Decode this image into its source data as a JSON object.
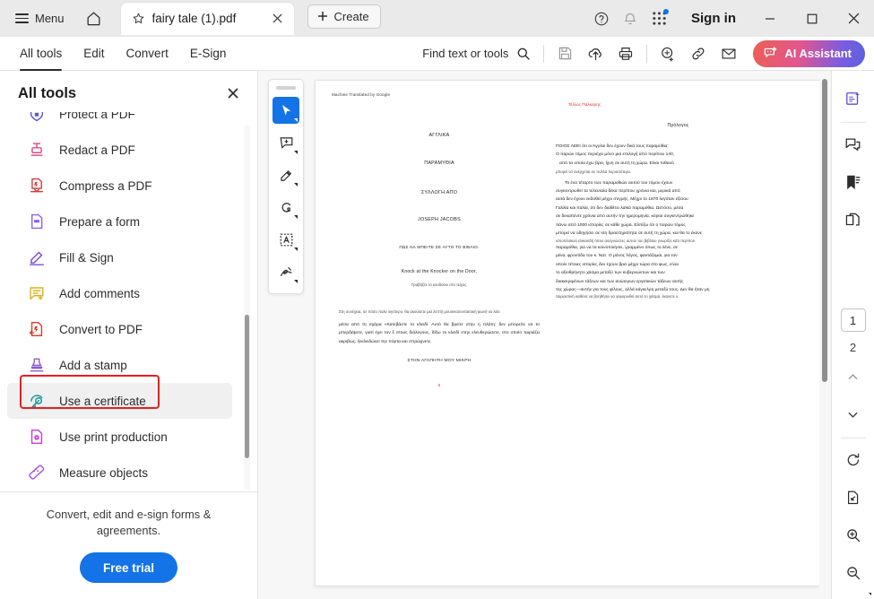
{
  "titlebar": {
    "menu_label": "Menu",
    "home_icon": "home-icon",
    "tab": {
      "favorite_icon": "star-icon",
      "title": "fairy tale (1).pdf",
      "close_icon": "close-icon"
    },
    "create_label": "Create",
    "help_icon": "help-circle-icon",
    "notification_icon": "bell-icon",
    "apps_icon": "apps-grid-icon",
    "signin_label": "Sign in",
    "minimize_icon": "minimize-icon",
    "maximize_icon": "maximize-icon",
    "close_icon": "window-close-icon"
  },
  "menubar": {
    "tabs": [
      {
        "label": "All tools",
        "active": true
      },
      {
        "label": "Edit",
        "active": false
      },
      {
        "label": "Convert",
        "active": false
      },
      {
        "label": "E-Sign",
        "active": false
      }
    ],
    "find_label": "Find text or tools",
    "find_icon": "search-icon",
    "actions": [
      {
        "name": "save-icon"
      },
      {
        "name": "cloud-upload-icon"
      },
      {
        "name": "print-icon"
      },
      {
        "name": "add-stamp-icon"
      },
      {
        "name": "link-icon"
      },
      {
        "name": "email-icon"
      }
    ],
    "ai_label": "AI Assistant",
    "ai_icon": "ai-sparkle-icon",
    "ai_gradient_from": "#ec5f52",
    "ai_gradient_to": "#5b62e0"
  },
  "sidebar": {
    "title": "All tools",
    "close_icon": "close-icon",
    "items": [
      {
        "label": "Protect a PDF",
        "icon": "shield-lock-icon",
        "color": "#5a5ad6",
        "clipped": true
      },
      {
        "label": "Redact a PDF",
        "icon": "redact-icon",
        "color": "#e34a8c"
      },
      {
        "label": "Compress a PDF",
        "icon": "compress-icon",
        "color": "#d43a3a"
      },
      {
        "label": "Prepare a form",
        "icon": "form-icon",
        "color": "#8b5cf0"
      },
      {
        "label": "Fill & Sign",
        "icon": "pen-sign-icon",
        "color": "#7b4ce0"
      },
      {
        "label": "Add comments",
        "icon": "comment-plus-icon",
        "color": "#e0b21a"
      },
      {
        "label": "Convert to PDF",
        "icon": "convert-pdf-icon",
        "color": "#e0392e"
      },
      {
        "label": "Add a stamp",
        "icon": "stamp-icon",
        "color": "#8a5ad0"
      },
      {
        "label": "Use a certificate",
        "icon": "certificate-icon",
        "color": "#1f9a9a",
        "highlighted": true
      },
      {
        "label": "Use print production",
        "icon": "print-production-icon",
        "color": "#c93ccf"
      },
      {
        "label": "Measure objects",
        "icon": "ruler-icon",
        "color": "#a64ce0"
      }
    ],
    "footer_text": "Convert, edit and e-sign forms & agreements.",
    "trial_button": "Free trial",
    "highlight_color": "#ef1a1a"
  },
  "viewer_tools": {
    "grip": "drag-handle",
    "buttons": [
      {
        "name": "select-tool-icon",
        "active": true
      },
      {
        "name": "add-comment-tool-icon",
        "active": false
      },
      {
        "name": "highlight-tool-icon",
        "active": false
      },
      {
        "name": "draw-tool-icon",
        "active": false
      },
      {
        "name": "text-select-tool-icon",
        "active": false
      },
      {
        "name": "signature-tool-icon",
        "active": false
      }
    ]
  },
  "document": {
    "watermark": "Machine Translated by Google",
    "red_header": "Τέλλος Πάλκαρης",
    "left_column": {
      "lines": [
        "ΑΓΓΛΙΚΑ",
        "ΠΑΡΑΜΥΘΙΑ",
        "ΣΥΛΛΟΓΗ ΑΠΟ",
        "JOSEPH JACOBS",
        "ΠΩΣ ΝΑ ΜΠΕΙΤΕ ΣΕ ΑΥΤΟ ΤΟ ΒΙΒΛΙΟ.",
        "Knock at the Knocker on the Door,"
      ],
      "small_line": "Τραβήξτε το κουδούνι στο τείχος.",
      "paragraph_small": "Στη συνέχεια, σε πόσο πολύ λιγότερο, θα ακούσετε μια λεπτή μουσικοσυντακτική φωνή να λέει:",
      "paragraph": "μέσα από τη σχάρα «Κατεβάστε το κλειδί.   Αυτό θα βρείτε στην η πλάτη: δεν μπορείτε να το μπερδέψετε, γιατί έχει τον ξ στους διάλογους, δίξω το κλειδί στην ελευθερώσετε, στο οποίο ταιριάζει ακριβώς, ξεκλειδώνει την πόρτα και σπρώχνετε.",
      "closing": "ΣΤΗΝ ΑΓΑΠΗΤΗ ΜΟΥ ΜΙΚΡΗ"
    },
    "right_column": {
      "heading": "Πρόλογος",
      "paragraphs": [
        "ΠΟΙΟΣ ΛΕΕΙ ότι οι Άγγλοι δεν έχουν δικά τους παραμύθια;",
        "Ο παρών τόμος περιέχει μόνο μια επιλογή από περίπου 140,",
        "από τα οποία έχω βρει, ίχνη σε αυτή τη χώρα. Είναι πιθανό"
      ],
      "small_note": "μπορεί να ανέρχεται σε πολλά περισσότερα.",
      "body": [
        "Το ένα τέταρτο των παραμυθιών αυτού του τόμου έχουν",
        "συγκεντρωθεί τα τελευταία δέκα περίπου χρόνια και, μερικά από",
        "αυτά δεν έχουν εκδοθεί μέχρι στιγμής. Μέχρι το 1870 λεγόταν εξίσου",
        "Γαλλία και Ιταλία, ότι δεν διαθέτει λαϊκά παραμύθια. Ωστόσο, μέσα",
        "σε δεκαπέντε χρόνια από αυτήν την ημερομηνία, κύριοι συγκεντρώθηκε",
        "πάνω από 1000 ιστορίες σε κάθε χώρα. Ελπίζω ότι ο παρών τόμος",
        "μπορεί να οδηγήσει σε ίση δραστηριότητα σε αυτή τη χώρα, και θα το έκανε",
        "ιστιοπλοϊκού ελικοειδή όπου αναγνώστες αυτού του βιβλίου γνωρίζει κάτι περίπου",
        "παραμύθια, για να τα κοινοποιήσει, γραμμένο όπως το λένε, σε",
        "μένα, φροντίδα του κ. Νατ. Ο μόνος λόγος, φαντάζομαι, για τον",
        "οποίο τέτοιες ιστορίες δεν έχουν βρει μέχρι τώρα στο φως, είναι",
        "το αξιοθρήνητο χάσμα μεταξύ των κυβερνώντων και των",
        "διακεκριμένων τάξεων και των ανώτερων εργατικών τάξεων αυτής",
        "της χώρας—αυτήν για τους φίλους, αλλά κάγκελρη μεταξύ τους. Δεν θα ήταν μη",
        "ταιριαστική καθένα να βοηθήσει να γεφυρωθεί αυτό το χάσμα, έκανετε ο"
      ]
    },
    "page_number": "5"
  },
  "right_rail": {
    "top_buttons": [
      {
        "name": "ai-summary-icon"
      },
      {
        "name": "comments-panel-icon"
      },
      {
        "name": "bookmarks-panel-icon"
      },
      {
        "name": "page-thumbnails-icon"
      }
    ],
    "current_page": "1",
    "next_page": "2",
    "prev_icon": "chevron-up-icon",
    "next_icon": "chevron-down-icon",
    "rotate_icon": "rotate-icon",
    "fit_page_icon": "fit-page-icon",
    "zoom_in_icon": "zoom-in-icon",
    "zoom_out_icon": "zoom-out-icon"
  }
}
